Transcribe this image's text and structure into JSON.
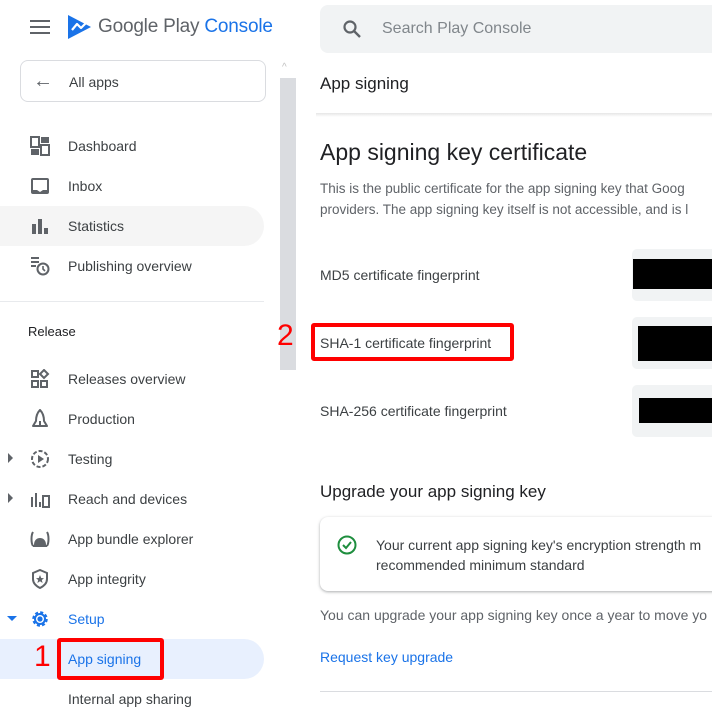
{
  "app": {
    "brand_main": "Google Play",
    "brand_accent": "Console",
    "accent_color": "#1a73e8"
  },
  "sidebar": {
    "all_apps_label": "All apps",
    "items": [
      {
        "label": "Dashboard",
        "icon": "dashboard-icon"
      },
      {
        "label": "Inbox",
        "icon": "inbox-icon"
      },
      {
        "label": "Statistics",
        "icon": "bar-chart-icon"
      },
      {
        "label": "Publishing overview",
        "icon": "publishing-schedule-icon"
      }
    ],
    "section_release": "Release",
    "release_items": [
      {
        "label": "Releases overview",
        "icon": "releases-overview-icon"
      },
      {
        "label": "Production",
        "icon": "rocket-icon"
      },
      {
        "label": "Testing",
        "icon": "testing-play-icon",
        "expandable": true
      },
      {
        "label": "Reach and devices",
        "icon": "reach-devices-icon",
        "expandable": true
      },
      {
        "label": "App bundle explorer",
        "icon": "android-bundle-icon"
      },
      {
        "label": "App integrity",
        "icon": "shield-star-icon"
      },
      {
        "label": "Setup",
        "icon": "gear-icon",
        "expanded": true
      },
      {
        "label": "App signing",
        "selected": true
      },
      {
        "label": "Internal app sharing"
      }
    ]
  },
  "search": {
    "placeholder": "Search Play Console"
  },
  "main": {
    "page_title": "App signing",
    "certificate_heading": "App signing key certificate",
    "certificate_desc_line1": "This is the public certificate for the app signing key that Goog",
    "certificate_desc_line2": "providers. The app signing key itself is not accessible, and is l",
    "fingerprints": [
      {
        "label": "MD5 certificate fingerprint",
        "value": "[redacted]"
      },
      {
        "label": "SHA-1 certificate fingerprint",
        "value": "[redacted]"
      },
      {
        "label": "SHA-256 certificate fingerprint",
        "value": "[redacted]"
      }
    ],
    "upgrade_heading": "Upgrade your app signing key",
    "upgrade_status_line1": "Your current app signing key's encryption strength m",
    "upgrade_status_line2": "recommended minimum standard",
    "upgrade_text": "You can upgrade your app signing key once a year to move yo",
    "request_upgrade_link": "Request key upgrade"
  },
  "annotations": [
    {
      "number": "1",
      "target": "App signing"
    },
    {
      "number": "2",
      "target": "SHA-1 certificate fingerprint"
    }
  ]
}
